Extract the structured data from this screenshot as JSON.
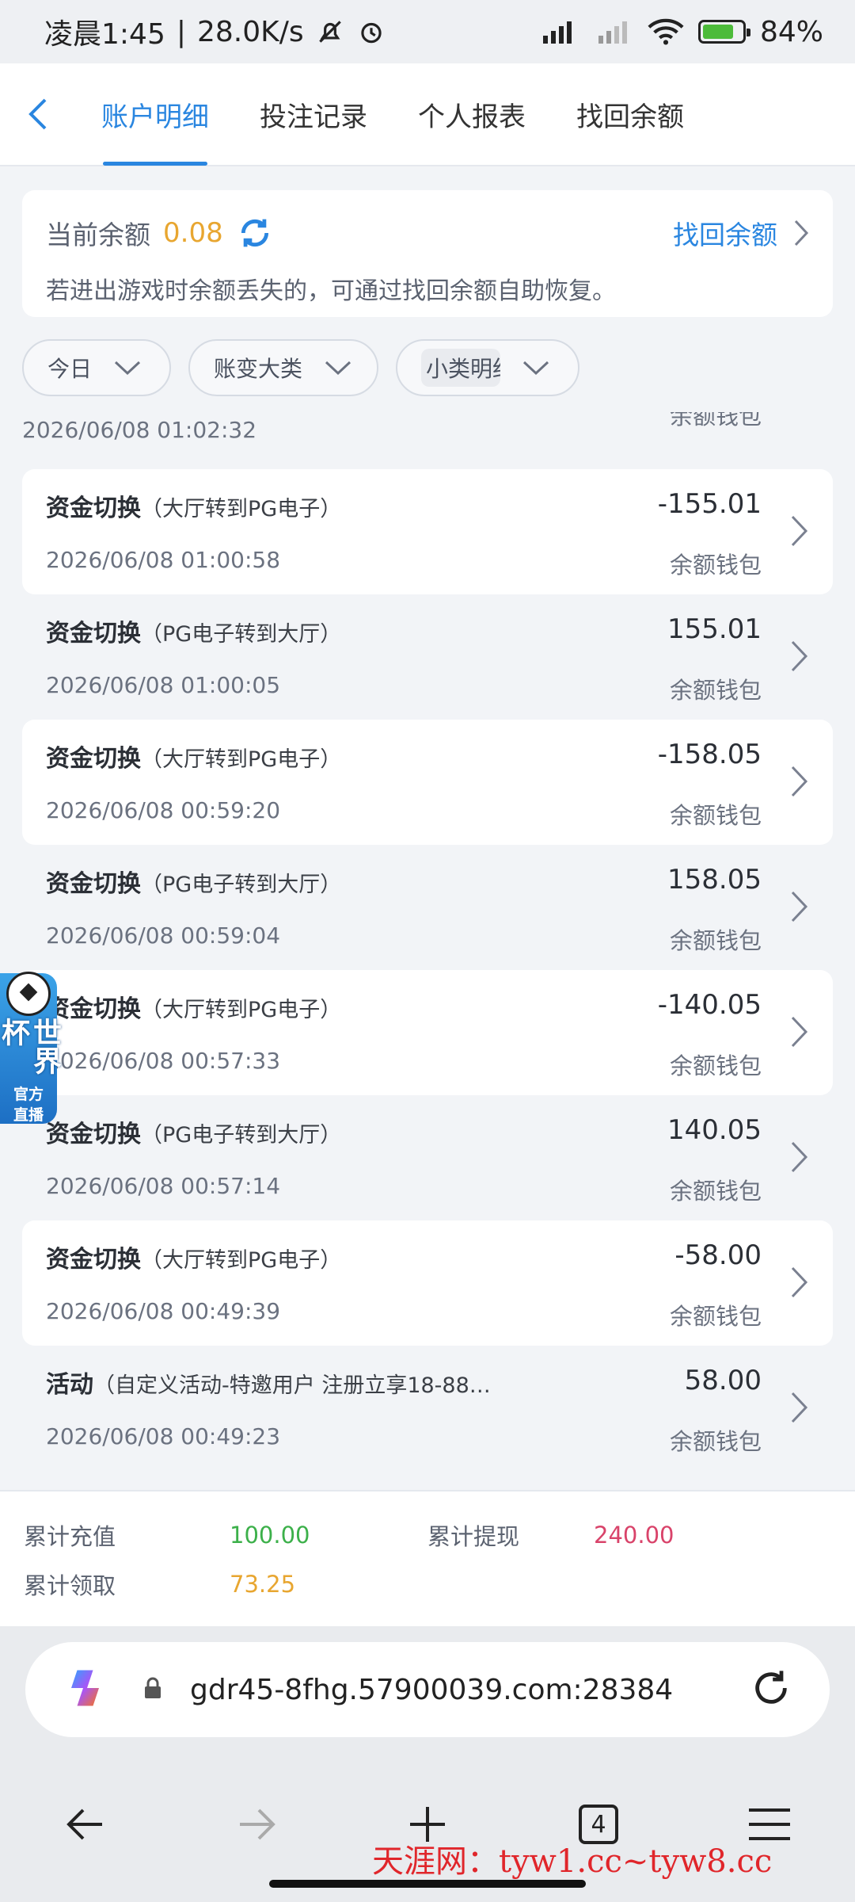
{
  "status_bar": {
    "time": "凌晨1:45",
    "net_speed": "28.0K/s",
    "battery": "84%"
  },
  "nav": {
    "tabs": [
      {
        "label": "账户明细"
      },
      {
        "label": "投注记录"
      },
      {
        "label": "个人报表"
      },
      {
        "label": "找回余额"
      }
    ]
  },
  "balance": {
    "label": "当前余额",
    "value": "0.08",
    "recover_link": "找回余额",
    "note": "若进出游戏时余额丢失的，可通过找回余额自助恢复。"
  },
  "filters": [
    {
      "label": "今日"
    },
    {
      "label": "账变大类"
    },
    {
      "label": "小类明细"
    }
  ],
  "records_partial": {
    "time": "2026/06/08 01:02:32",
    "wallet": "余额钱包"
  },
  "records": [
    {
      "title": "资金切换",
      "detail": "（大厅转到PG电子）",
      "time": "2026/06/08 01:00:58",
      "amount": "-155.01",
      "wallet": "余额钱包"
    },
    {
      "title": "资金切换",
      "detail": "（PG电子转到大厅）",
      "time": "2026/06/08 01:00:05",
      "amount": "155.01",
      "wallet": "余额钱包"
    },
    {
      "title": "资金切换",
      "detail": "（大厅转到PG电子）",
      "time": "2026/06/08 00:59:20",
      "amount": "-158.05",
      "wallet": "余额钱包"
    },
    {
      "title": "资金切换",
      "detail": "（PG电子转到大厅）",
      "time": "2026/06/08 00:59:04",
      "amount": "158.05",
      "wallet": "余额钱包"
    },
    {
      "title": "资金切换",
      "detail": "（大厅转到PG电子）",
      "time": "2026/06/08 00:57:33",
      "amount": "-140.05",
      "wallet": "余额钱包"
    },
    {
      "title": "资金切换",
      "detail": "（PG电子转到大厅）",
      "time": "2026/06/08 00:57:14",
      "amount": "140.05",
      "wallet": "余额钱包"
    },
    {
      "title": "资金切换",
      "detail": "（大厅转到PG电子）",
      "time": "2026/06/08 00:49:39",
      "amount": "-58.00",
      "wallet": "余额钱包"
    },
    {
      "title": "活动",
      "detail": "（自定义活动-特邀用户 注册立享18-88…",
      "time": "2026/06/08 00:49:23",
      "amount": "58.00",
      "wallet": "余额钱包"
    }
  ],
  "totals": {
    "recharge_label": "累计充值",
    "recharge_value": "100.00",
    "withdraw_label": "累计提现",
    "withdraw_value": "240.00",
    "claim_label": "累计领取",
    "claim_value": "73.25"
  },
  "browser": {
    "url": "gdr45-8fhg.57900039.com:28384",
    "tab_count": "4"
  },
  "world_cup_badge": {
    "main": "世界杯",
    "sub1": "官方",
    "sub2": "直播"
  },
  "watermark": "天涯网：tyw1.cc~tyw8.cc",
  "colors": {
    "accent": "#2a86e0",
    "balance": "#e8a630",
    "recharge": "#3cb04a",
    "withdraw": "#d9436a"
  }
}
